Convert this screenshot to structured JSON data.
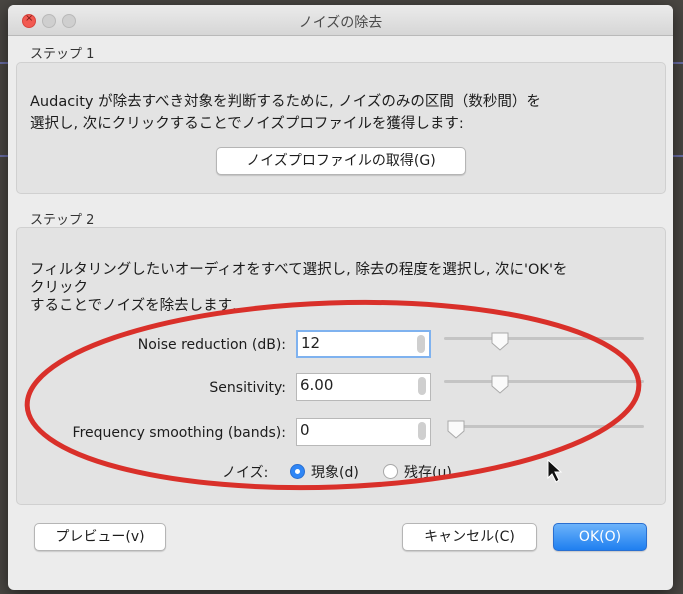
{
  "window": {
    "title": "ノイズの除去"
  },
  "step1": {
    "label": "ステップ 1",
    "description_line1": "Audacity が除去すべき対象を判断するために, ノイズのみの区間（数秒間）を",
    "description_line2": "選択し, 次にクリックすることでノイズプロファイルを獲得します:",
    "profile_button": "ノイズプロファイルの取得(G)"
  },
  "step2": {
    "label": "ステップ 2",
    "description_line1": "フィルタリングしたいオーディオをすべて選択し, 除去の程度を選択し, 次に'OK'を",
    "description_line2": "クリック",
    "description_line3": "することでノイズを除去します.",
    "fields": [
      {
        "label": "Noise reduction (dB):",
        "value": "12",
        "slider_fraction": 0.28
      },
      {
        "label": "Sensitivity:",
        "value": "6.00",
        "slider_fraction": 0.28
      },
      {
        "label": "Frequency smoothing (bands):",
        "value": "0",
        "slider_fraction": 0.0
      }
    ],
    "noise_label": "ノイズ:",
    "radio_options": [
      {
        "label": "現象(d)",
        "selected": true
      },
      {
        "label": "残存(u)",
        "selected": false
      }
    ]
  },
  "footer": {
    "preview_button": "プレビュー(v)",
    "cancel_button": "キャンセル(C)",
    "ok_button": "OK(O)"
  },
  "colors": {
    "accent": "#2f86f6",
    "annotation_ellipse": "#d9302a"
  }
}
